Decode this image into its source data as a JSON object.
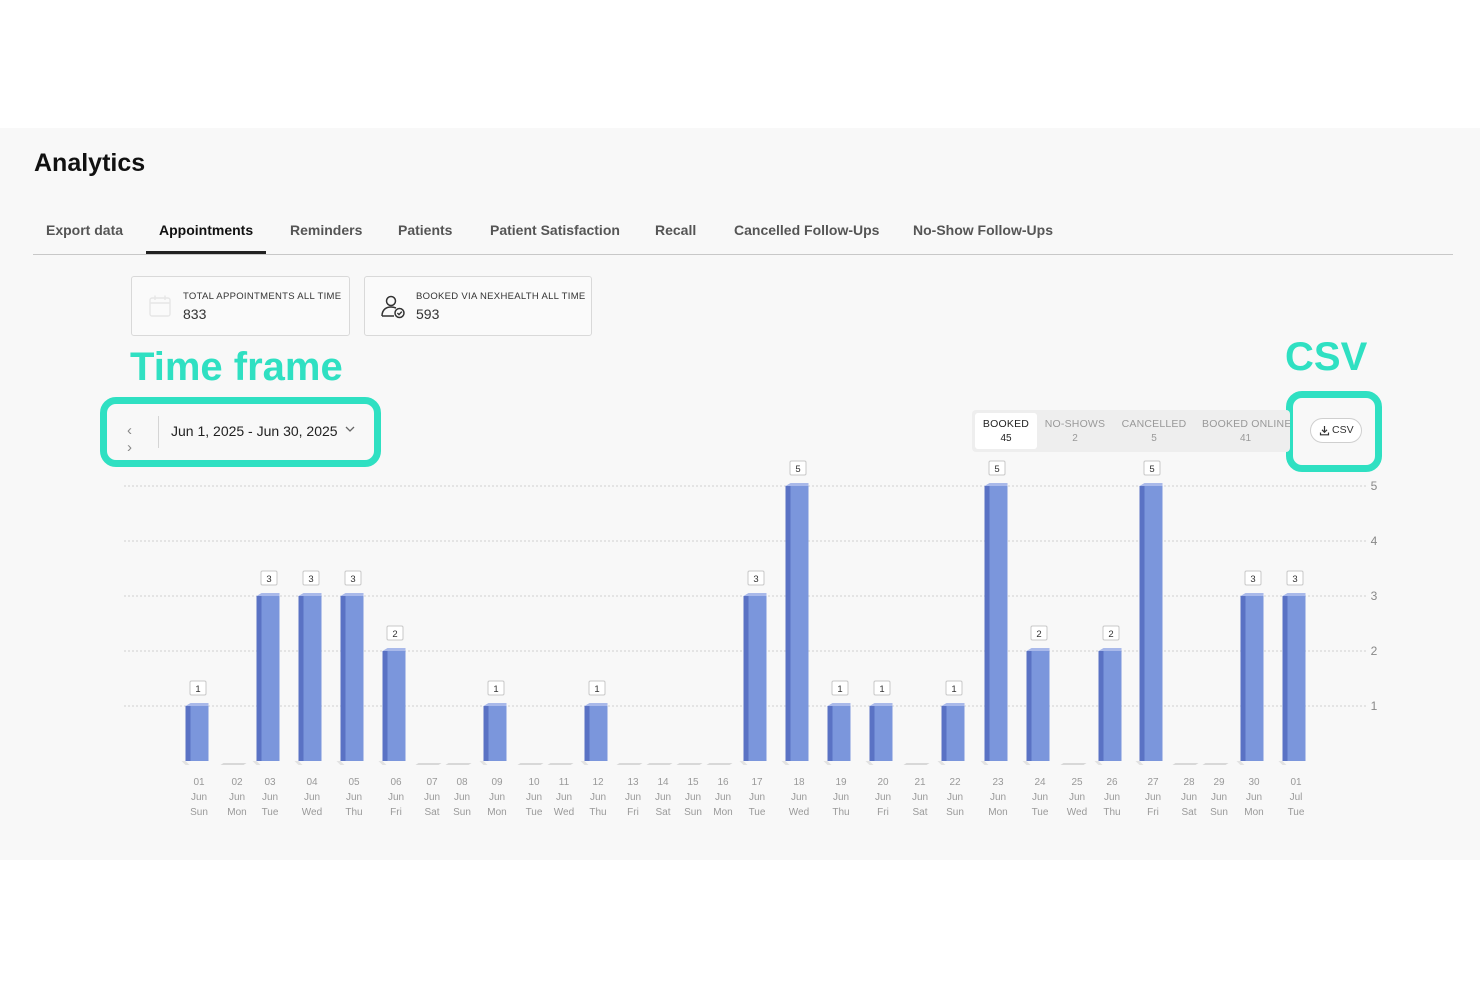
{
  "page": {
    "title": "Analytics"
  },
  "tabs": [
    {
      "label": "Export data",
      "active": false
    },
    {
      "label": "Appointments",
      "active": true
    },
    {
      "label": "Reminders",
      "active": false
    },
    {
      "label": "Patients",
      "active": false
    },
    {
      "label": "Patient Satisfaction",
      "active": false
    },
    {
      "label": "Recall",
      "active": false
    },
    {
      "label": "Cancelled Follow-Ups",
      "active": false
    },
    {
      "label": "No-Show Follow-Ups",
      "active": false
    }
  ],
  "stats": [
    {
      "label": "TOTAL APPOINTMENTS ALL TIME",
      "value": "833",
      "icon": "calendar-icon"
    },
    {
      "label": "BOOKED VIA NEXHEALTH ALL TIME",
      "value": "593",
      "icon": "user-check-icon"
    }
  ],
  "annotations": {
    "time_frame": "Time frame",
    "csv": "CSV"
  },
  "date_range": {
    "label": "Jun 1, 2025 - Jun 30, 2025"
  },
  "metric_tabs": [
    {
      "label": "BOOKED",
      "count": "45",
      "active": true
    },
    {
      "label": "NO-SHOWS",
      "count": "2",
      "active": false
    },
    {
      "label": "CANCELLED",
      "count": "5",
      "active": false
    },
    {
      "label": "BOOKED ONLINE",
      "count": "41",
      "active": false
    }
  ],
  "csv_button": {
    "label": "CSV",
    "icon": "download-icon"
  },
  "colors": {
    "accent": "#2fe0c2",
    "bar_front": "#7b96dc",
    "bar_side": "#5a72c4",
    "bar_top": "#a9b9ea"
  },
  "chart_data": {
    "type": "bar",
    "series": [
      {
        "values": [
          1,
          0,
          3,
          3,
          3,
          2,
          0,
          0,
          1,
          0,
          0,
          1,
          0,
          0,
          0,
          0,
          3,
          5,
          1,
          1,
          0,
          1,
          5,
          2,
          0,
          2,
          5,
          0,
          0,
          3,
          3
        ]
      }
    ],
    "categories": [
      {
        "day": "01",
        "month": "Jun",
        "weekday": "Sun"
      },
      {
        "day": "02",
        "month": "Jun",
        "weekday": "Mon"
      },
      {
        "day": "03",
        "month": "Jun",
        "weekday": "Tue"
      },
      {
        "day": "04",
        "month": "Jun",
        "weekday": "Wed"
      },
      {
        "day": "05",
        "month": "Jun",
        "weekday": "Thu"
      },
      {
        "day": "06",
        "month": "Jun",
        "weekday": "Fri"
      },
      {
        "day": "07",
        "month": "Jun",
        "weekday": "Sat"
      },
      {
        "day": "08",
        "month": "Jun",
        "weekday": "Sun"
      },
      {
        "day": "09",
        "month": "Jun",
        "weekday": "Mon"
      },
      {
        "day": "10",
        "month": "Jun",
        "weekday": "Tue"
      },
      {
        "day": "11",
        "month": "Jun",
        "weekday": "Wed"
      },
      {
        "day": "12",
        "month": "Jun",
        "weekday": "Thu"
      },
      {
        "day": "13",
        "month": "Jun",
        "weekday": "Fri"
      },
      {
        "day": "14",
        "month": "Jun",
        "weekday": "Sat"
      },
      {
        "day": "15",
        "month": "Jun",
        "weekday": "Sun"
      },
      {
        "day": "16",
        "month": "Jun",
        "weekday": "Mon"
      },
      {
        "day": "17",
        "month": "Jun",
        "weekday": "Tue"
      },
      {
        "day": "18",
        "month": "Jun",
        "weekday": "Wed"
      },
      {
        "day": "19",
        "month": "Jun",
        "weekday": "Thu"
      },
      {
        "day": "20",
        "month": "Jun",
        "weekday": "Fri"
      },
      {
        "day": "21",
        "month": "Jun",
        "weekday": "Sat"
      },
      {
        "day": "22",
        "month": "Jun",
        "weekday": "Sun"
      },
      {
        "day": "23",
        "month": "Jun",
        "weekday": "Mon"
      },
      {
        "day": "24",
        "month": "Jun",
        "weekday": "Tue"
      },
      {
        "day": "25",
        "month": "Jun",
        "weekday": "Wed"
      },
      {
        "day": "26",
        "month": "Jun",
        "weekday": "Thu"
      },
      {
        "day": "27",
        "month": "Jun",
        "weekday": "Fri"
      },
      {
        "day": "28",
        "month": "Jun",
        "weekday": "Sat"
      },
      {
        "day": "29",
        "month": "Jun",
        "weekday": "Sun"
      },
      {
        "day": "30",
        "month": "Jun",
        "weekday": "Mon"
      },
      {
        "day": "01",
        "month": "Jul",
        "weekday": "Tue"
      }
    ],
    "y_ticks": [
      "1",
      "2",
      "3",
      "4",
      "5"
    ],
    "ylim": [
      0,
      5
    ],
    "grid": true,
    "data_labels": true,
    "y_axis_side": "right"
  }
}
